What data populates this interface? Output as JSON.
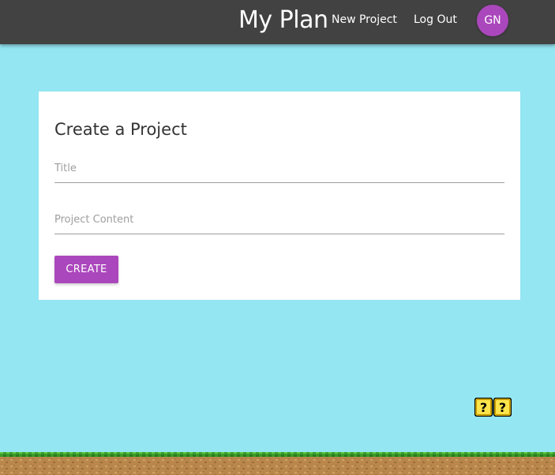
{
  "header": {
    "brand": "My Plan",
    "nav": {
      "new_project": "New Project",
      "log_out": "Log Out"
    },
    "avatar_initials": "GN",
    "colors": {
      "bar": "#424242",
      "avatar": "#ab47bc"
    }
  },
  "form": {
    "title": "Create a Project",
    "title_field": {
      "placeholder": "Title",
      "value": ""
    },
    "content_field": {
      "placeholder": "Project Content",
      "value": ""
    },
    "submit_label": "CREATE"
  },
  "decor": {
    "blocks_icon": "question-block-icon",
    "ground_icon": "grass-ground",
    "background": "#93e6f2"
  }
}
